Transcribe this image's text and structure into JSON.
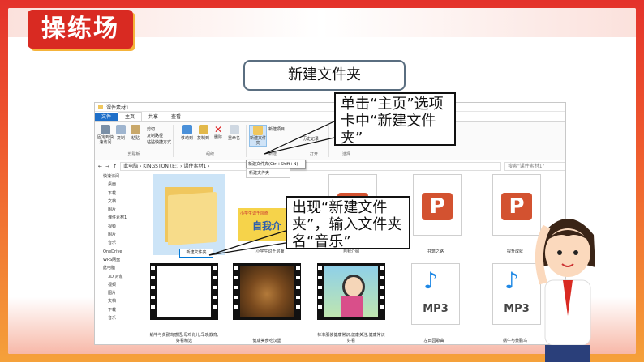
{
  "slide": {
    "title": "操练场",
    "topic": "新建文件夹",
    "callout1": "单击“主页”选项卡中“新建文件夹”",
    "callout2": "出现“新建文件夹”，输入文件夹名“音乐”"
  },
  "explorer": {
    "window_title": "课件素材1",
    "tabs": [
      "文件",
      "主页",
      "共享",
      "查看"
    ],
    "ribbon": {
      "pin": "固定到快速访问",
      "copy": "复制",
      "paste": "粘贴",
      "cut": "剪切",
      "copy_path": "复制路径",
      "paste_shortcut": "粘贴快捷方式",
      "group_clipboard": "剪贴板",
      "move_to": "移动到",
      "copy_to": "复制到",
      "delete": "删除",
      "rename": "重命名",
      "group_organize": "组织",
      "new_item": "新建项目",
      "new_folder": "新建文件夹",
      "group_new": "新建",
      "group_open": "打开",
      "history": "历史记录",
      "group_select": "选择"
    },
    "tooltip": "新建文件夹(Ctrl+Shift+N)",
    "dropdown_item": "新建文件夹",
    "address_path": "此电脑 › KINGSTON (E:) › 课件素材1 ›",
    "search_placeholder": "搜索\"课件素材1\"",
    "nav": [
      "快速访问",
      "桌面",
      "下载",
      "文档",
      "图片",
      "课件素材1",
      "视频",
      "图片",
      "音乐",
      "OneDrive",
      "WPS网盘",
      "此电脑",
      "3D 对象",
      "视频",
      "图片",
      "文档",
      "下载",
      "音乐"
    ],
    "rename_value": "新建文件夹",
    "files": [
      {
        "name": "",
        "type": "folder"
      },
      {
        "name": "小学生识千层面",
        "type": "image"
      },
      {
        "name": "自我介绍",
        "type": "ppt"
      },
      {
        "name": "共筑之路",
        "type": "ppt"
      },
      {
        "name": "提升成就",
        "type": "ppt"
      },
      {
        "name": "蜗牛与黄鹂鸟感悟,母鸡肯儿,早晚教育,好看精选",
        "type": "video"
      },
      {
        "name": "健康美食吃汉堡",
        "type": "video"
      },
      {
        "name": "标准服装健康常识,健康关注,健康常识好看",
        "type": "video"
      },
      {
        "name": "左田园歌曲",
        "type": "mp3"
      },
      {
        "name": "蜗牛与黄鹂鸟",
        "type": "mp3"
      }
    ],
    "thumb_text": "小学生识千层面",
    "thumb_big": "自我介",
    "mp3_label": "MP3"
  },
  "colors": {
    "accent_red": "#d92a22",
    "ppt_orange": "#d35230",
    "file_tab_blue": "#1e6fc9",
    "folder_yellow": "#f0c75e"
  }
}
